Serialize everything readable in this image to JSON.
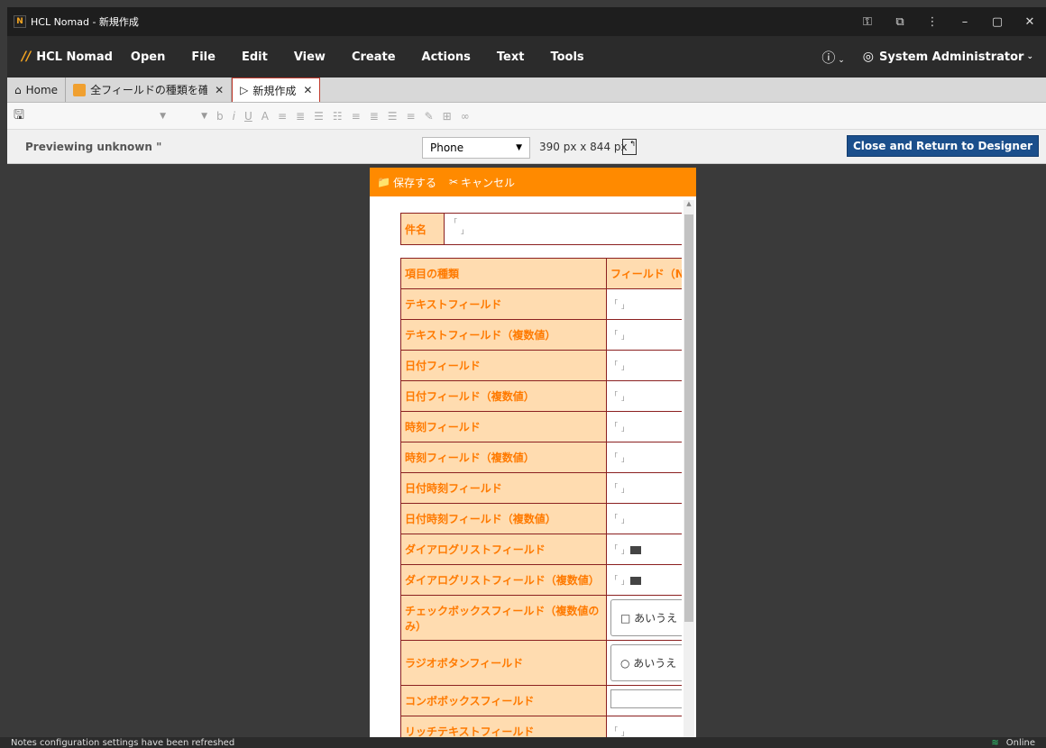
{
  "window": {
    "title": "HCL Nomad - 新規作成",
    "logo_text": "N"
  },
  "menubar": {
    "brand": "HCL Nomad",
    "items": [
      "Open",
      "File",
      "Edit",
      "View",
      "Create",
      "Actions",
      "Text",
      "Tools"
    ],
    "help_glyph": "?",
    "user": "System Administrator"
  },
  "tabs": [
    {
      "label": "Home"
    },
    {
      "label": "全フィールドの種類を確認"
    },
    {
      "label": "新規作成"
    }
  ],
  "previewbar": {
    "label": "Previewing unknown \"",
    "device": "Phone",
    "dims": "390 px x 844 px",
    "close_button": "Close and Return to Designer"
  },
  "phone": {
    "save_label": "保存する",
    "cancel_label": "キャンセル",
    "subject_label": "件名",
    "table_headers": [
      "項目の種類",
      "フィールド（N"
    ],
    "rows": [
      {
        "label": "テキストフィールド",
        "kind": "text"
      },
      {
        "label": "テキストフィールド（複数値）",
        "kind": "text"
      },
      {
        "label": "日付フィールド",
        "kind": "text"
      },
      {
        "label": "日付フィールド（複数値）",
        "kind": "text"
      },
      {
        "label": "時刻フィールド",
        "kind": "text"
      },
      {
        "label": "時刻フィールド（複数値）",
        "kind": "text"
      },
      {
        "label": "日付時刻フィールド",
        "kind": "text"
      },
      {
        "label": "日付時刻フィールド（複数値）",
        "kind": "text"
      },
      {
        "label": "ダイアログリストフィールド",
        "kind": "dialog"
      },
      {
        "label": "ダイアログリストフィールド（複数値）",
        "kind": "dialog"
      },
      {
        "label": "チェックボックスフィールド（複数値のみ）",
        "kind": "checkbox",
        "option": "□ あいうえ"
      },
      {
        "label": "ラジオボタンフィールド",
        "kind": "radio",
        "option": "○ あいうえ"
      },
      {
        "label": "コンボボックスフィールド",
        "kind": "combo"
      },
      {
        "label": "リッチテキストフィールド",
        "kind": "text"
      }
    ]
  },
  "statusbar": {
    "message": "Notes configuration settings have been refreshed",
    "online": "Online"
  }
}
